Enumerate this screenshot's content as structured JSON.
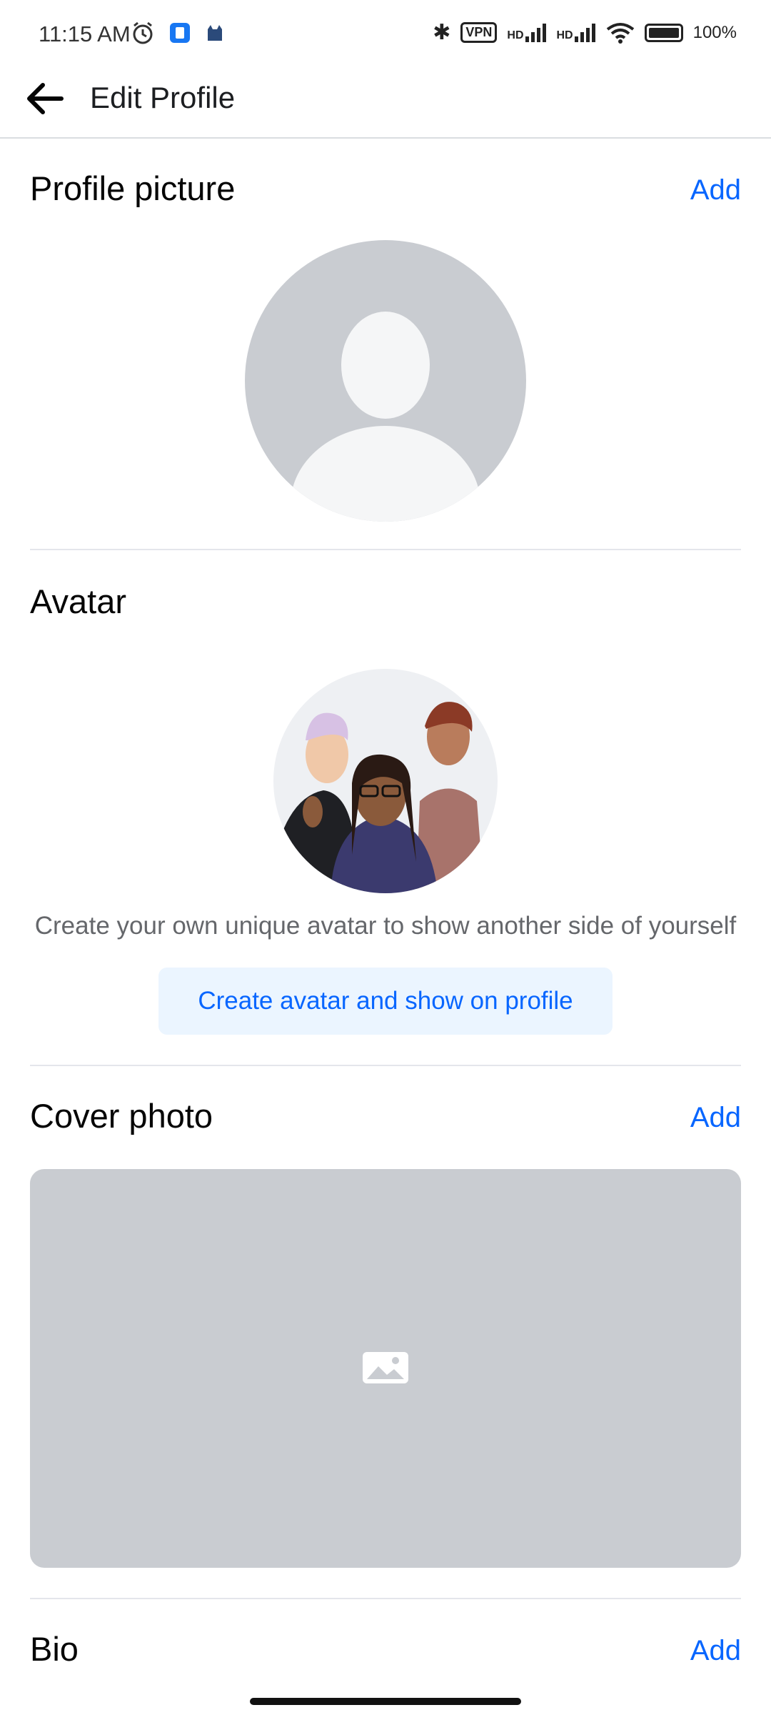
{
  "status_bar": {
    "time": "11:15 AM",
    "vpn": "VPN",
    "signal_1": "HD",
    "signal_2": "HD",
    "battery": "100%"
  },
  "header": {
    "title": "Edit Profile"
  },
  "profile_picture": {
    "title": "Profile picture",
    "add_label": "Add"
  },
  "avatar": {
    "title": "Avatar",
    "description": "Create your own unique avatar to show another side of yourself",
    "button_label": "Create avatar and show on profile"
  },
  "cover_photo": {
    "title": "Cover photo",
    "add_label": "Add"
  },
  "bio": {
    "title": "Bio",
    "add_label": "Add"
  },
  "colors": {
    "accent": "#0866ff",
    "placeholder_gray": "#c9ccd1",
    "button_bg": "#ebf5ff"
  }
}
